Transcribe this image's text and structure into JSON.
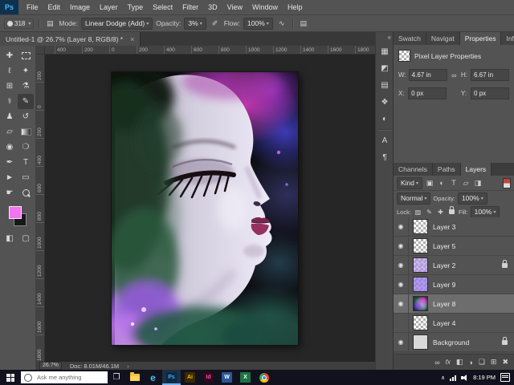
{
  "app": {
    "logo": "Ps"
  },
  "icons": {
    "chevron_down": "▾",
    "panel_toggle": "▤",
    "pen_pressure": "✐",
    "airbrush": "∿",
    "brush_panel": "▤",
    "link": "∞",
    "eye": "◉",
    "collapse": "«",
    "tab_close": "×",
    "status_arrow": "›",
    "tray_up": "∧",
    "fx": "fx",
    "mask": "◧",
    "adjustment": "◑",
    "group": "❏",
    "new_layer": "⊞",
    "delete": "✖",
    "filter_pixel": "▣",
    "filter_adjust": "◐",
    "filter_type": "T",
    "filter_shape": "▱",
    "filter_smart": "◨",
    "lock_transparency": "▨",
    "lock_pixels": "✎",
    "lock_position": "✚",
    "taskview": "❐"
  },
  "menu": {
    "items": [
      "File",
      "Edit",
      "Image",
      "Layer",
      "Type",
      "Select",
      "Filter",
      "3D",
      "View",
      "Window",
      "Help"
    ]
  },
  "options": {
    "brush_size": "318",
    "mode_label": "Mode:",
    "mode_value": "Linear Dodge (Add)",
    "opacity_label": "Opacity:",
    "opacity_value": "3%",
    "flow_label": "Flow:",
    "flow_value": "100%"
  },
  "document": {
    "tab_title": "Untitled-1 @ 26.7% (Layer 8, RGB/8) *"
  },
  "rulers": {
    "h": [
      "400",
      "200",
      "0",
      "200",
      "400",
      "600",
      "800",
      "1000",
      "1200",
      "1400",
      "1600",
      "1800"
    ],
    "v": [
      "200",
      "0",
      "200",
      "400",
      "600",
      "800",
      "1000",
      "1200",
      "1400",
      "1600",
      "1800"
    ]
  },
  "toolbar": {
    "tools": [
      {
        "name": "move",
        "glyph": "✚"
      },
      {
        "name": "rectangular-marquee",
        "glyph": ""
      },
      {
        "name": "lasso",
        "glyph": "ℓ"
      },
      {
        "name": "quick-selection",
        "glyph": "✦"
      },
      {
        "name": "crop",
        "glyph": "⊞"
      },
      {
        "name": "eyedropper",
        "glyph": "⚗"
      },
      {
        "name": "spot-healing-brush",
        "glyph": "⚕"
      },
      {
        "name": "brush",
        "glyph": "✎",
        "selected": true
      },
      {
        "name": "clone-stamp",
        "glyph": "♟"
      },
      {
        "name": "history-brush",
        "glyph": "↺"
      },
      {
        "name": "eraser",
        "glyph": "▱"
      },
      {
        "name": "gradient",
        "glyph": ""
      },
      {
        "name": "blur",
        "glyph": "◉"
      },
      {
        "name": "dodge",
        "glyph": "❍"
      },
      {
        "name": "pen",
        "glyph": "✒"
      },
      {
        "name": "type",
        "glyph": "T"
      },
      {
        "name": "path-selection",
        "glyph": "►"
      },
      {
        "name": "rectangle-shape",
        "glyph": "▭"
      },
      {
        "name": "hand",
        "glyph": "☛"
      },
      {
        "name": "zoom",
        "glyph": ""
      },
      {
        "name": "quick-mask",
        "glyph": "◧"
      },
      {
        "name": "screen-mode",
        "glyph": "▢"
      }
    ]
  },
  "strip": {
    "icons": [
      {
        "name": "swatches",
        "glyph": "▦"
      },
      {
        "name": "adjustments",
        "glyph": "◩"
      },
      {
        "name": "libraries",
        "glyph": "▤"
      },
      {
        "name": "styles",
        "glyph": "❖"
      },
      {
        "name": "clone-source",
        "glyph": "◐"
      },
      {
        "name": "character",
        "glyph": "A"
      },
      {
        "name": "paragraph",
        "glyph": "¶"
      }
    ]
  },
  "properties_panel": {
    "tabs": [
      "Swatch",
      "Navigat",
      "Properties",
      "Info"
    ],
    "title": "Pixel Layer Properties",
    "w_label": "W:",
    "w_value": "4.67 in",
    "h_label": "H:",
    "h_value": "6.67 in",
    "x_label": "X:",
    "x_value": "0 px",
    "y_label": "Y:",
    "y_value": "0 px"
  },
  "layers_panel": {
    "tabs": [
      "Channels",
      "Paths",
      "Layers"
    ],
    "kind_label": "Kind",
    "blend_mode": "Normal",
    "opacity_label": "Opacity:",
    "opacity_value": "100%",
    "lock_label": "Lock:",
    "fill_label": "Fill:",
    "fill_value": "100%",
    "layers": [
      {
        "name": "Layer 3",
        "visible": true,
        "locked": false,
        "selected": false
      },
      {
        "name": "Layer 5",
        "visible": true,
        "locked": false,
        "selected": false
      },
      {
        "name": "Layer 2",
        "visible": true,
        "locked": true,
        "selected": false
      },
      {
        "name": "Layer 9",
        "visible": true,
        "locked": false,
        "selected": false
      },
      {
        "name": "Layer 8",
        "visible": true,
        "locked": false,
        "selected": true
      },
      {
        "name": "Layer 4",
        "visible": false,
        "locked": false,
        "selected": false
      },
      {
        "name": "Background",
        "visible": true,
        "locked": true,
        "selected": false
      }
    ]
  },
  "status": {
    "zoom": "26.7%",
    "doc": "Doc: 8.01M/46.1M"
  },
  "taskbar": {
    "search_placeholder": "Ask me anything",
    "apps": [
      {
        "name": "file-explorer",
        "label": ""
      },
      {
        "name": "edge",
        "label": "e"
      },
      {
        "name": "photoshop",
        "label": "Ps",
        "active": true
      },
      {
        "name": "illustrator",
        "label": "Ai"
      },
      {
        "name": "indesign",
        "label": "Id"
      },
      {
        "name": "word",
        "label": "W"
      },
      {
        "name": "excel",
        "label": "X"
      },
      {
        "name": "chrome",
        "label": ""
      }
    ],
    "time": "8:19 PM"
  },
  "colors": {
    "fg_style": "background:#f274f2",
    "bg_style": "background:#181818",
    "taskbar_active_underline": "#6cb2f7"
  }
}
